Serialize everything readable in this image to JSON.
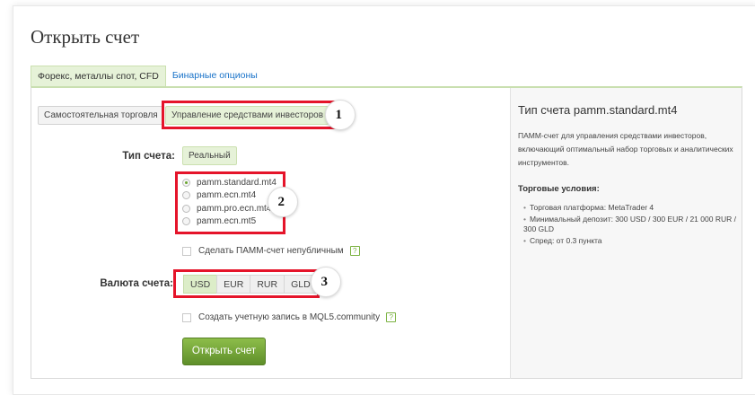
{
  "page": {
    "title": "Открыть счет"
  },
  "tabs": [
    {
      "label": "Форекс, металлы спот, CFD",
      "active": true
    },
    {
      "label": "Бинарные опционы",
      "active": false
    }
  ],
  "mode_buttons": [
    {
      "label": "Самостоятельная торговля",
      "active": false
    },
    {
      "label": "Управление средствами инвесторов",
      "active": true
    }
  ],
  "account_type": {
    "label": "Тип счета:",
    "value": "Реальный"
  },
  "radio_options": [
    {
      "label": "pamm.standard.mt4",
      "checked": true
    },
    {
      "label": "pamm.ecn.mt4",
      "checked": false
    },
    {
      "label": "pamm.pro.ecn.mt4",
      "checked": false
    },
    {
      "label": "pamm.ecn.mt5",
      "checked": false
    }
  ],
  "private_checkbox": {
    "label": "Сделать ПАММ-счет непубличным",
    "help": "?"
  },
  "currency": {
    "label": "Валюта счета:",
    "options": [
      "USD",
      "EUR",
      "RUR",
      "GLD"
    ],
    "selected": "USD"
  },
  "mql5_checkbox": {
    "label": "Создать учетную запись в MQL5.community",
    "help": "?"
  },
  "submit_button": {
    "label": "Открыть счет"
  },
  "annotations": [
    "1",
    "2",
    "3"
  ],
  "sidebar": {
    "title": "Тип счета pamm.standard.mt4",
    "description": "ПАММ-счет для управления средствами инвесторов, включающий оптимальный набор торговых и аналитических инструментов.",
    "conditions_title": "Торговые условия:",
    "conditions": [
      "Торговая платформа: MetaTrader 4",
      "Минимальный депозит: 300 USD / 300 EUR / 21 000 RUR / 300 GLD",
      "Спред: от 0.3 пункта"
    ]
  },
  "colors": {
    "accent_green": "#6aa52f",
    "annotation_red": "#e5142a",
    "link_blue": "#1a73c9"
  }
}
